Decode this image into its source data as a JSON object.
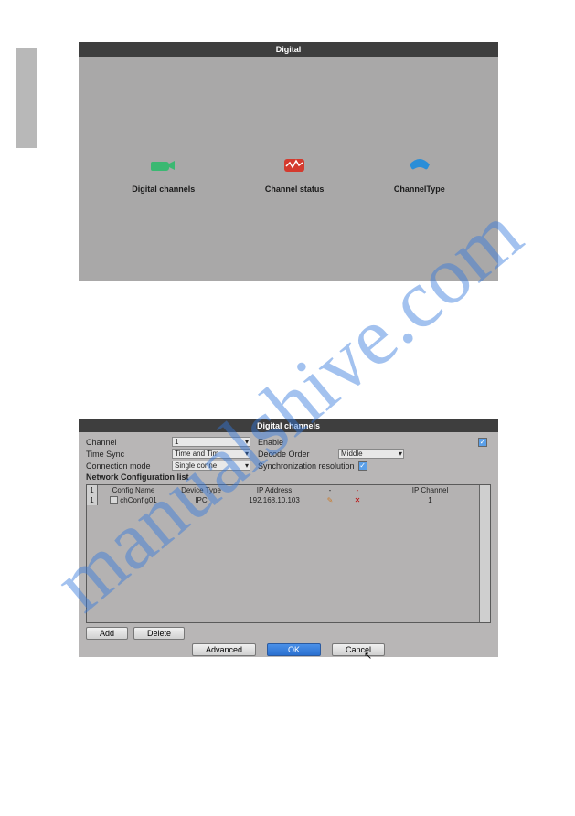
{
  "watermark": "manualshive.com",
  "panel1": {
    "title": "Digital",
    "items": [
      {
        "label": "Digital channels",
        "icon": "camera-icon"
      },
      {
        "label": "Channel status",
        "icon": "status-icon"
      },
      {
        "label": "ChannelType",
        "icon": "phone-icon"
      }
    ]
  },
  "panel2": {
    "title": "Digital channels",
    "fields": {
      "channel_label": "Channel",
      "channel_value": "1",
      "enable_label": "Enable",
      "enable_checked": "✓",
      "timesync_label": "Time Sync",
      "timesync_value": "Time and Tim",
      "decode_label": "Decode Order",
      "decode_value": "Middle",
      "conn_label": "Connection mode",
      "conn_value": "Single conne",
      "sync_label": "Synchronization resolution",
      "sync_checked": "✓",
      "list_label": "Network Configuration list"
    },
    "table": {
      "headers": {
        "idx": "1",
        "name": "Config Name",
        "type": "Device Type",
        "ip": "IP Address",
        "edit": "-",
        "del": "-",
        "ch": "IP Channel"
      },
      "rows": [
        {
          "idx": "1",
          "name": "chConfig01",
          "type": "IPC",
          "ip": "192.168.10.103",
          "edit": "✎",
          "del": "✕",
          "ch": "1"
        }
      ]
    },
    "buttons": {
      "add": "Add",
      "delete": "Delete",
      "advanced": "Advanced",
      "ok": "OK",
      "cancel": "Cancel"
    }
  }
}
